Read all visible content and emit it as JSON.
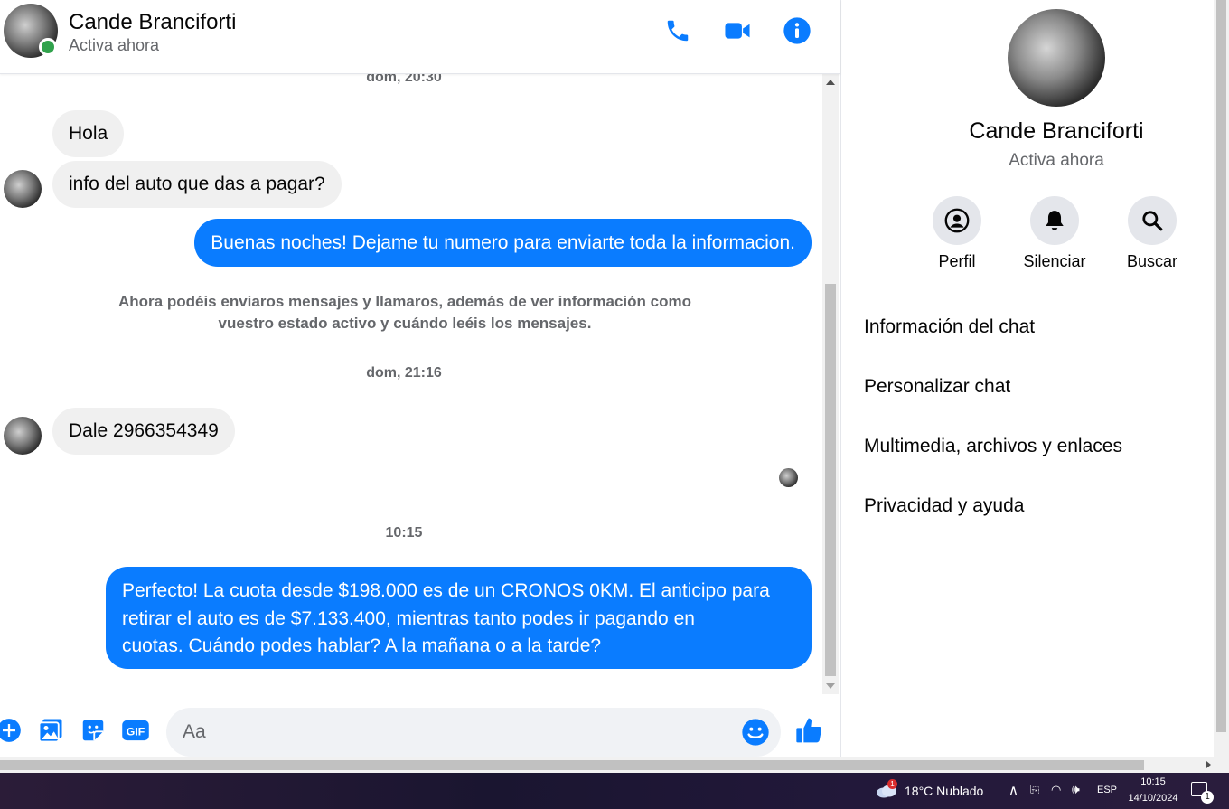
{
  "chat": {
    "contact_name": "Cande Branciforti",
    "contact_status": "Activa ahora",
    "timestamps": [
      "dom, 20:30",
      "dom, 21:16",
      "10:15"
    ],
    "messages": [
      {
        "dir": "in",
        "text": "Hola"
      },
      {
        "dir": "in",
        "text": "info del auto que das a pagar?"
      },
      {
        "dir": "out",
        "text": "Buenas noches! Dejame tu numero para enviarte toda la informacion."
      },
      {
        "dir": "in",
        "text": "Dale 2966354349"
      },
      {
        "dir": "out",
        "lines": [
          "Perfecto! La cuota desde $198.000 es de un CRONOS 0KM. El anticipo para",
          "retirar el auto es de $7.133.400, mientras tanto podes ir pagando en",
          "cuotas. Cuándo podes hablar? A la mañana o a la tarde?"
        ]
      }
    ],
    "system_note": [
      "Ahora podéis enviaros mensajes y llamaros, además de ver información como",
      "vuestro estado activo y cuándo leéis los mensajes."
    ],
    "composer_placeholder": "Aa"
  },
  "info_panel": {
    "name": "Cande Branciforti",
    "status": "Activa ahora",
    "actions": [
      "Perfil",
      "Silenciar",
      "Buscar"
    ],
    "menu": [
      "Información del chat",
      "Personalizar chat",
      "Multimedia, archivos y enlaces",
      "Privacidad y ayuda"
    ]
  },
  "taskbar": {
    "weather": "18°C  Nublado",
    "weather_badge": "1",
    "lang": "ESP",
    "time": "10:15",
    "date": "14/10/2024",
    "notif_count": "1"
  },
  "colors": {
    "accent": "#0a7cff",
    "incoming_bubble": "#f0f0f0",
    "online": "#31a24c",
    "muted_text": "#65676b"
  }
}
